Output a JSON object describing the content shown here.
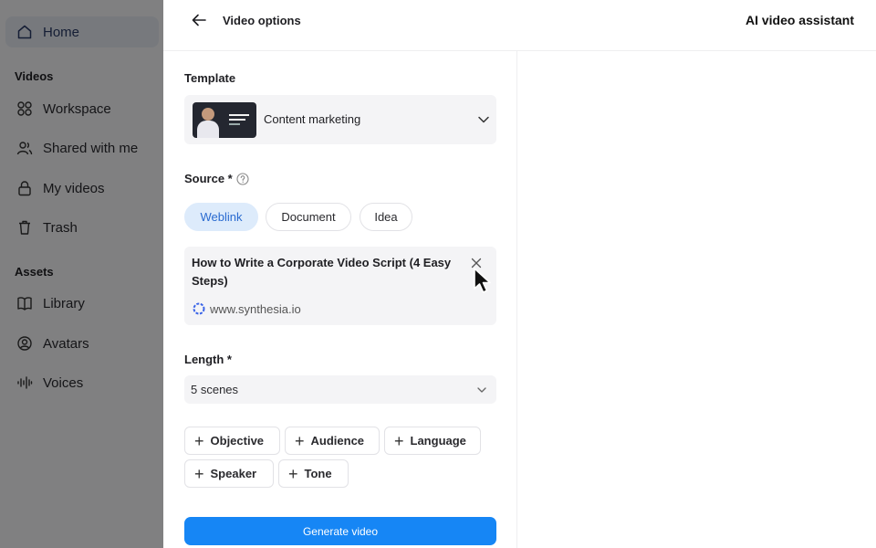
{
  "sidebar": {
    "items": [
      {
        "label": "Home",
        "icon": "home-icon",
        "active": true
      },
      {
        "label": "Workspace",
        "icon": "grid-icon"
      },
      {
        "label": "Shared with me",
        "icon": "users-icon"
      },
      {
        "label": "My videos",
        "icon": "lock-icon"
      },
      {
        "label": "Trash",
        "icon": "trash-icon"
      },
      {
        "label": "Library",
        "icon": "book-icon"
      },
      {
        "label": "Avatars",
        "icon": "avatar-icon"
      },
      {
        "label": "Voices",
        "icon": "waveform-icon"
      }
    ],
    "sections": {
      "videos": "Videos",
      "assets": "Assets"
    }
  },
  "header": {
    "title": "Video options",
    "right_title": "AI video assistant"
  },
  "template": {
    "label": "Template",
    "selected": "Content marketing"
  },
  "source": {
    "label": "Source *",
    "tabs": [
      "Weblink",
      "Document",
      "Idea"
    ],
    "selected_tab": "Weblink",
    "card": {
      "title": "How to Write a Corporate Video Script (4 Easy Steps)",
      "url": "www.synthesia.io"
    }
  },
  "length": {
    "label": "Length *",
    "value": "5 scenes"
  },
  "options": [
    "Objective",
    "Audience",
    "Language",
    "Speaker",
    "Tone"
  ],
  "generate_label": "Generate video",
  "colors": {
    "accent": "#1686f5",
    "selected_pill_bg": "#ddebfb",
    "selected_pill_text": "#2a6bd0"
  }
}
